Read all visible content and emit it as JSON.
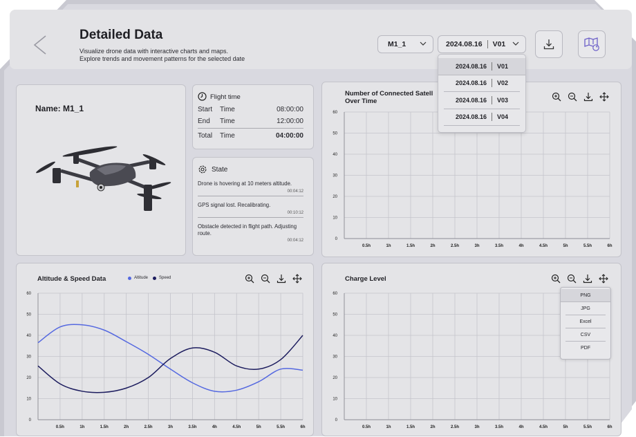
{
  "header": {
    "title": "Detailed Data",
    "description_line1": "Visualize drone data with interactive charts and maps.",
    "description_line2": "Explore trends and movement patterns for the selected date",
    "drone_select": "M1_1",
    "date_select": {
      "date": "2024.08.16",
      "version": "V01"
    },
    "download_icon": "download-icon",
    "map_icon": "map-refresh-icon"
  },
  "date_dropdown": [
    {
      "date": "2024.08.16",
      "version": "V01"
    },
    {
      "date": "2024.08.16",
      "version": "V02"
    },
    {
      "date": "2024.08.16",
      "version": "V03"
    },
    {
      "date": "2024.08.16",
      "version": "V04"
    }
  ],
  "drone": {
    "name": "Name: M1_1"
  },
  "flight_time": {
    "title": "Flight time",
    "start": {
      "a": "Start",
      "b": "Time",
      "value": "08:00:00"
    },
    "end": {
      "a": "End",
      "b": "Time",
      "value": "12:00:00"
    },
    "total": {
      "a": "Total",
      "b": "Time",
      "value": "04:00:00"
    }
  },
  "state": {
    "title": "State",
    "messages": [
      {
        "text": "Drone is hovering at 10 meters altitude.",
        "time": "00:04:12"
      },
      {
        "text": "GPS signal lost. Recalibrating.",
        "time": "00:10:12"
      },
      {
        "text": "Obstacle detected in flight path. Adjusting route.",
        "time": "00:04:12"
      }
    ]
  },
  "charts": {
    "satellites": {
      "title_line1": "Number of Connected Satell",
      "title_line2": "Over Time"
    },
    "altitude": {
      "title": "Altitude & Speed Data",
      "legend_altitude": "Altitude",
      "legend_speed": "Speed"
    },
    "charge": {
      "title": "Charge Level"
    }
  },
  "export_menu": [
    "PNG",
    "JPG",
    "Excel",
    "CSV",
    "PDF"
  ],
  "colors": {
    "altitude": "#5468e0",
    "speed": "#1c1c5e",
    "accent": "#7b6fd6"
  },
  "chart_data": [
    {
      "type": "line",
      "title": "Number of Connected Satellites Over Time",
      "x": [
        "0.5h",
        "1h",
        "1.5h",
        "2h",
        "2.5h",
        "3h",
        "3.5h",
        "4h",
        "4.5h",
        "5h",
        "5.5h",
        "6h"
      ],
      "yticks": [
        0,
        10,
        20,
        30,
        40,
        50,
        60
      ],
      "ylim": [
        0,
        60
      ],
      "series": [],
      "grid": true
    },
    {
      "type": "line",
      "title": "Altitude & Speed Data",
      "x": [
        "0.5h",
        "1h",
        "1.5h",
        "2h",
        "2.5h",
        "3h",
        "3.5h",
        "4h",
        "4.5h",
        "5h",
        "5.5h",
        "6h"
      ],
      "yticks": [
        0,
        10,
        20,
        30,
        40,
        50,
        60
      ],
      "ylim": [
        0,
        60
      ],
      "series": [
        {
          "name": "Altitude",
          "x": [
            0,
            0.5,
            1,
            1.5,
            2,
            2.5,
            3,
            3.5,
            4,
            4.5,
            5,
            5.5,
            6
          ],
          "values": [
            36.5,
            44,
            45,
            42.5,
            37,
            31,
            24,
            17.5,
            13.5,
            14,
            18,
            24,
            23.5
          ]
        },
        {
          "name": "Speed",
          "x": [
            0,
            0.5,
            1,
            1.5,
            2,
            2.5,
            3,
            3.5,
            4,
            4.5,
            5,
            5.5,
            6
          ],
          "values": [
            25.5,
            17,
            13.5,
            13,
            15,
            20,
            29,
            34,
            32,
            25.5,
            24,
            28.5,
            40
          ]
        }
      ],
      "grid": true,
      "legend": "top"
    },
    {
      "type": "line",
      "title": "Charge Level",
      "x": [
        "0.5h",
        "1h",
        "1.5h",
        "2h",
        "2.5h",
        "3h",
        "3.5h",
        "4h",
        "4.5h",
        "5h",
        "5.5h",
        "6h"
      ],
      "yticks": [
        0,
        10,
        20,
        30,
        40,
        50,
        60
      ],
      "ylim": [
        0,
        60
      ],
      "series": [],
      "grid": true
    }
  ]
}
